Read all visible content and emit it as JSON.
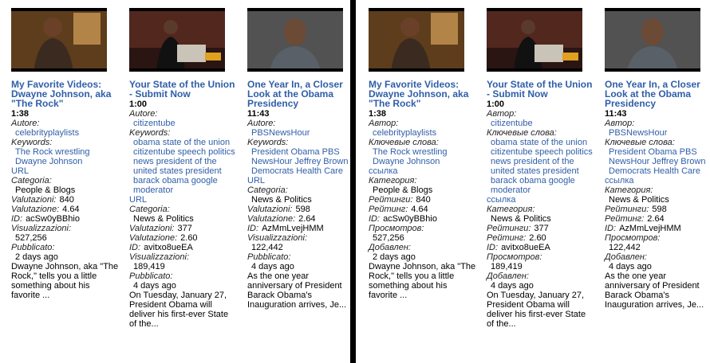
{
  "cards": [
    {
      "title": "My Favorite Videos: Dwayne Johnson, aka \"The Rock\"",
      "duration": "1:38",
      "labels": {
        "author": "Autore:",
        "keywords": "Keywords:",
        "url": "URL",
        "category": "Categoria:",
        "ratings": "Valutazioni:",
        "rating": "Valutazione:",
        "id": "ID:",
        "views": "Visualizzazioni:",
        "published": "Pubblicato:"
      },
      "author": "celebrityplaylists",
      "keywords": [
        "The Rock wrestling",
        "Dwayne Johnson"
      ],
      "category": "People & Blogs",
      "ratings": "840",
      "rating": "4.64",
      "id": "acSw0yBBhio",
      "views": "527,256",
      "published": "2 days ago",
      "description": "Dwayne Johnson, aka \"The Rock,\" tells you a little something about his favorite ..."
    },
    {
      "title": "Your State of the Union - Submit Now",
      "duration": "1:00",
      "labels": {
        "author": "Autore:",
        "keywords": "Keywords:",
        "url": "URL",
        "category": "Categoria:",
        "ratings": "Valutazioni:",
        "rating": "Valutazione:",
        "id": "ID:",
        "views": "Visualizzazioni:",
        "published": "Pubblicato:"
      },
      "author": "citizentube",
      "keywords": [
        "obama state of the union citizentube speech politics news president of the united states president barack obama google moderator"
      ],
      "category": "News & Politics",
      "ratings": "377",
      "rating": "2.60",
      "id": "avitxo8ueEA",
      "views": "189,419",
      "published": "4 days ago",
      "description": "On Tuesday, January 27, President Obama will deliver his first-ever State of the..."
    },
    {
      "title": "One Year In, a Closer Look at the Obama Presidency",
      "duration": "11:43",
      "labels": {
        "author": "Autore:",
        "keywords": "Keywords:",
        "url": "URL",
        "category": "Categoria:",
        "ratings": "Valutazioni:",
        "rating": "Valutazione:",
        "id": "ID:",
        "views": "Visualizzazioni:",
        "published": "Pubblicato:"
      },
      "author": "PBSNewsHour",
      "keywords": [
        "President Obama PBS NewsHour Jeffrey Brown Democrats Health Care"
      ],
      "category": "News & Politics",
      "ratings": "598",
      "rating": "2.64",
      "id": "AzMmLvejHMM",
      "views": "122,442",
      "published": "4 days ago",
      "description": "As the one year anniversary of President Barack Obama's Inauguration arrives, Je..."
    },
    {
      "title": "My Favorite Videos: Dwayne Johnson, aka \"The Rock\"",
      "duration": "1:38",
      "labels": {
        "author": "Автор:",
        "keywords": "Ключевые слова:",
        "url": "ссылка",
        "category": "Категория:",
        "ratings": "Рейтинги:",
        "rating": "Рейтинг:",
        "id": "ID:",
        "views": "Просмотров:",
        "published": "Добавлен:"
      },
      "author": "celebrityplaylists",
      "keywords": [
        "The Rock wrestling",
        "Dwayne Johnson"
      ],
      "category": "People & Blogs",
      "ratings": "840",
      "rating": "4.64",
      "id": "acSw0yBBhio",
      "views": "527,256",
      "published": "2 days ago",
      "description": "Dwayne Johnson, aka \"The Rock,\" tells you a little something about his favorite ..."
    },
    {
      "title": "Your State of the Union - Submit Now",
      "duration": "1:00",
      "labels": {
        "author": "Автор:",
        "keywords": "Ключевые слова:",
        "url": "ссылка",
        "category": "Категория:",
        "ratings": "Рейтинги:",
        "rating": "Рейтинг:",
        "id": "ID:",
        "views": "Просмотров:",
        "published": "Добавлен:"
      },
      "author": "citizentube",
      "keywords": [
        "obama state of the union citizentube speech politics news president of the united states president barack obama google moderator"
      ],
      "category": "News & Politics",
      "ratings": "377",
      "rating": "2.60",
      "id": "avitxo8ueEA",
      "views": "189,419",
      "published": "4 days ago",
      "description": "On Tuesday, January 27, President Obama will deliver his first-ever State of the..."
    },
    {
      "title": "One Year In, a Closer Look at the Obama Presidency",
      "duration": "11:43",
      "labels": {
        "author": "Автор:",
        "keywords": "Ключевые слова:",
        "url": "ссылка",
        "category": "Категория:",
        "ratings": "Рейтинги:",
        "rating": "Рейтинг:",
        "id": "ID:",
        "views": "Просмотров:",
        "published": "Добавлен:"
      },
      "author": "PBSNewsHour",
      "keywords": [
        "President Obama PBS NewsHour Jeffrey Brown Democrats Health Care"
      ],
      "category": "News & Politics",
      "ratings": "598",
      "rating": "2.64",
      "id": "AzMmLvejHMM",
      "views": "122,442",
      "published": "4 days ago",
      "description": "As the one year anniversary of President Barack Obama's Inauguration arrives, Je..."
    }
  ],
  "colors": {
    "link": "#2f5fa8",
    "divider": "#000000"
  }
}
